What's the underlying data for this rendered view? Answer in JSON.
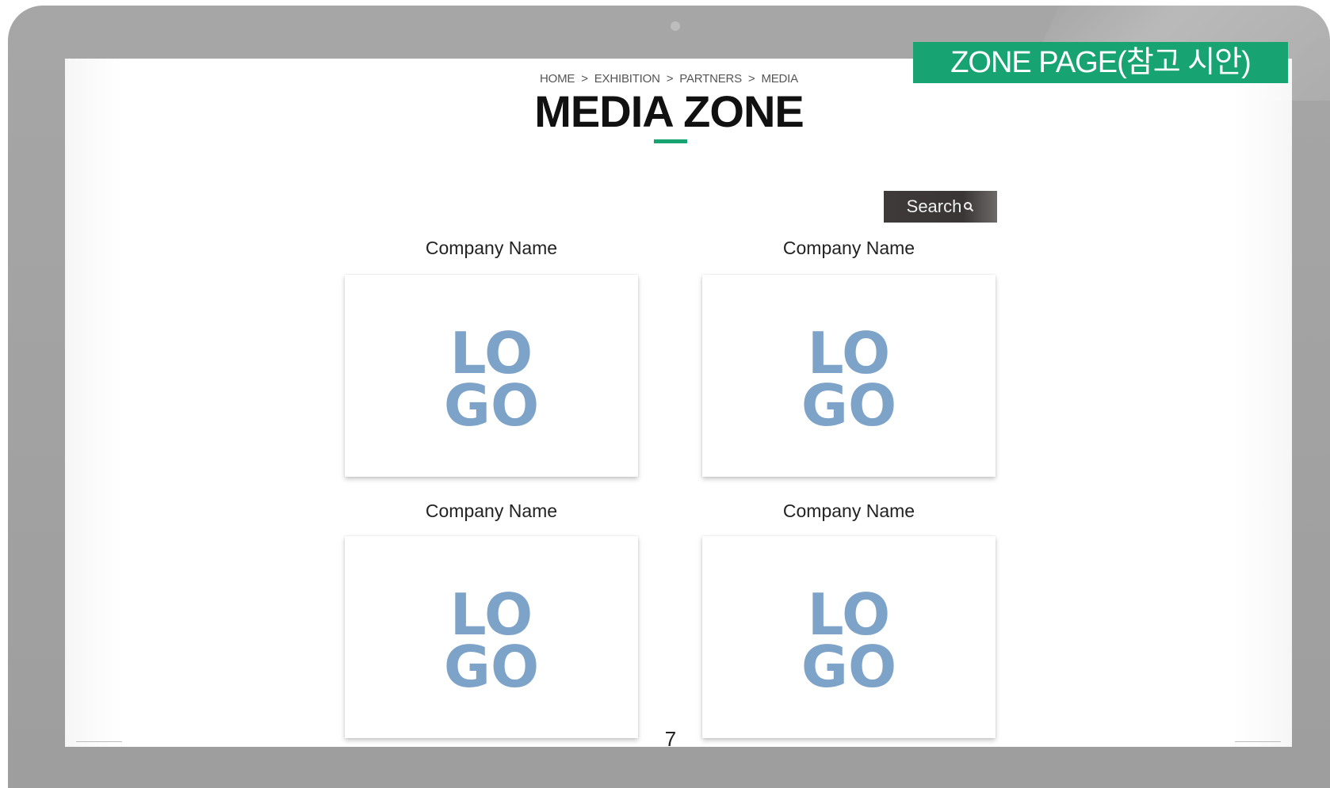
{
  "badge": {
    "label": "ZONE PAGE(참고 시안)",
    "color": "#17a372"
  },
  "breadcrumb": {
    "items": [
      "HOME",
      "EXHIBITION",
      "PARTNERS",
      "MEDIA"
    ],
    "separator": ">"
  },
  "page": {
    "title": "MEDIA ZONE",
    "accent_color": "#17a372",
    "page_number": "7"
  },
  "search": {
    "label": "Search",
    "icon": "search-icon"
  },
  "partners": [
    {
      "company_name": "Company Name",
      "logo_text": [
        "LO",
        "GO"
      ],
      "logo_color": "#7ea3c8"
    },
    {
      "company_name": "Company Name",
      "logo_text": [
        "LO",
        "GO"
      ],
      "logo_color": "#7ea3c8"
    },
    {
      "company_name": "Company Name",
      "logo_text": [
        "LO",
        "GO"
      ],
      "logo_color": "#7ea3c8"
    },
    {
      "company_name": "Company Name",
      "logo_text": [
        "LO",
        "GO"
      ],
      "logo_color": "#7ea3c8"
    }
  ]
}
